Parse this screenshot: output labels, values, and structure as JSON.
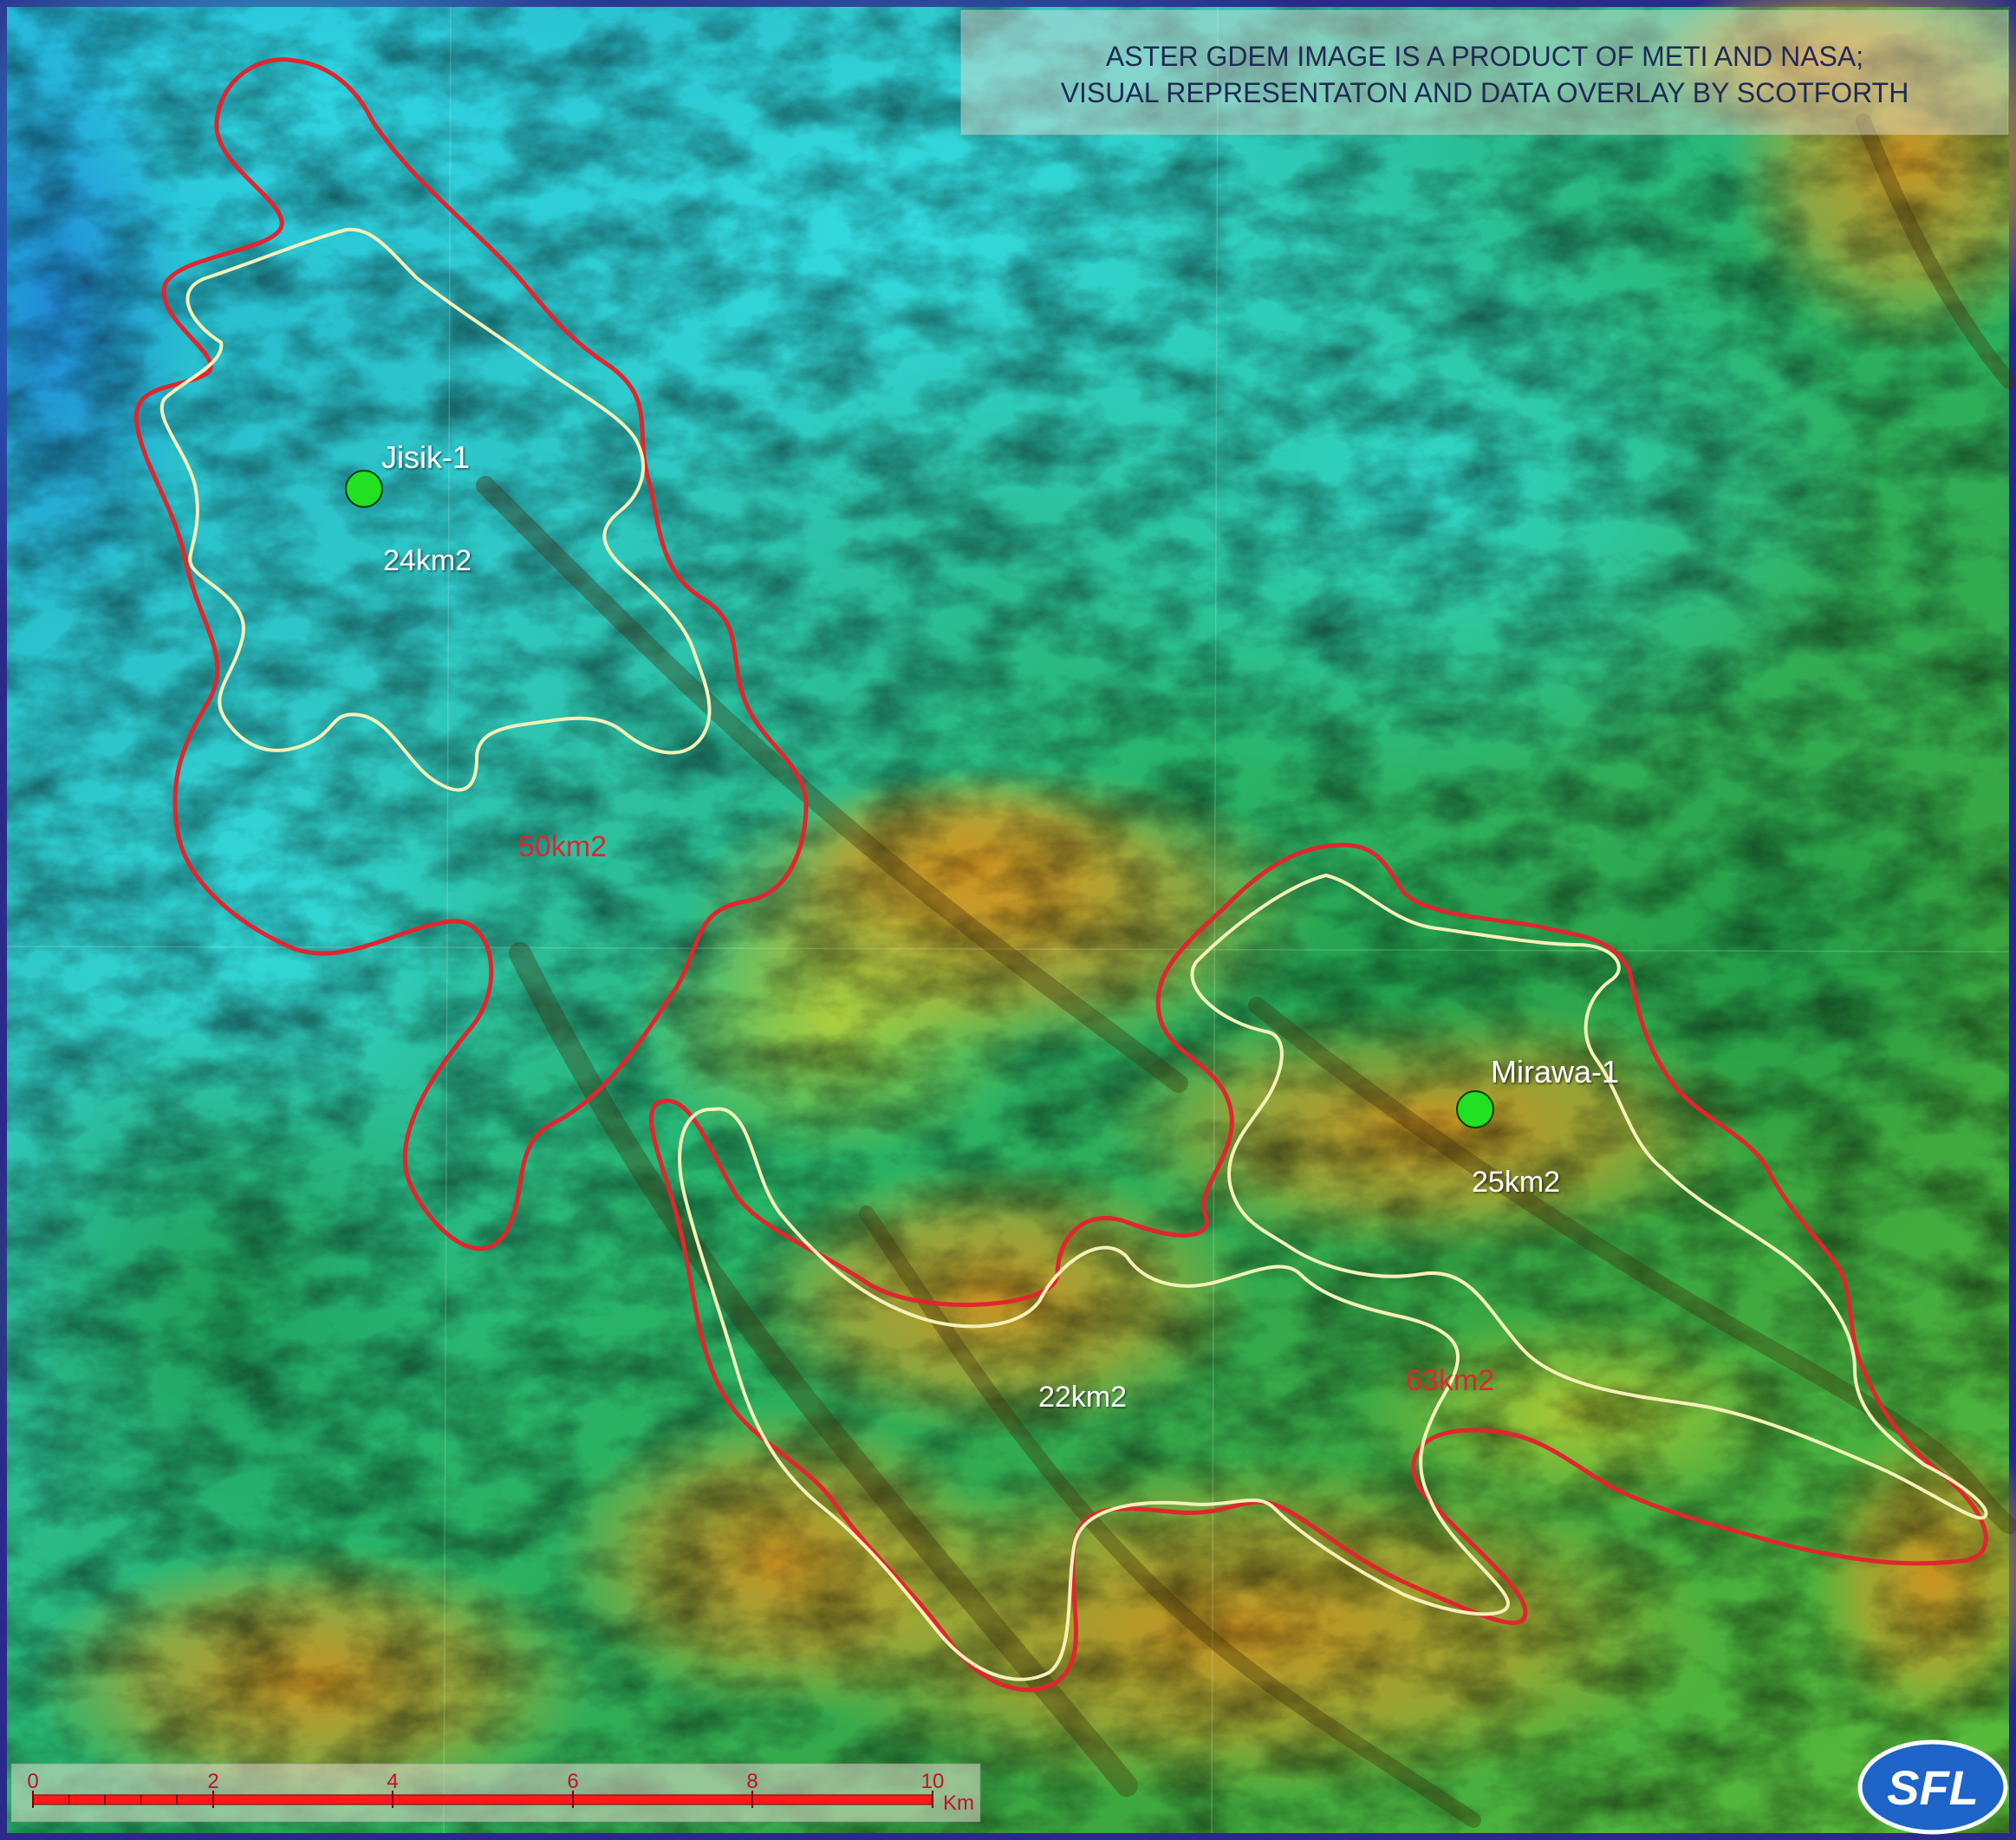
{
  "credit": {
    "line1": "ASTER GDEM IMAGE IS A PRODUCT OF METI AND NASA;",
    "line2": "VISUAL REPRESENTATON AND DATA OVERLAY BY SCOTFORTH"
  },
  "wells": [
    {
      "name": "Jisik-1"
    },
    {
      "name": "Mirawa-1"
    }
  ],
  "areas": {
    "inner_jisik": "24km2",
    "outer_jisik": "50km2",
    "inner_mirawa": "25km2",
    "inner_south": "22km2",
    "outer_mirawa": "63km2"
  },
  "scale_bar": {
    "ticks": [
      "0",
      "2",
      "4",
      "6",
      "8",
      "10"
    ],
    "unit": "Km"
  },
  "logo": {
    "text": "SFL"
  },
  "colors": {
    "outer_boundary": "#e0262e",
    "inner_boundary": "#f4f1b8",
    "well_marker": "#22e022",
    "label_white": "#ffffff",
    "label_red": "#e0262e",
    "scale_bar": "#ff1a1a",
    "logo_bg": "#1e63c8",
    "frame": "#2a2a8a"
  }
}
